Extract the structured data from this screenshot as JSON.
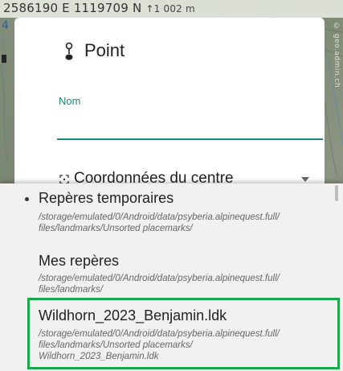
{
  "map": {
    "coordinates": "2586190 E  1119709 N",
    "altitude": "↑1 002 m",
    "side_number": "4",
    "copyright": "© geo.admin.ch"
  },
  "dialog": {
    "title": "Point",
    "field_label": "Nom",
    "field_value": "",
    "coord_label": "Coordonnées du centre"
  },
  "popup": {
    "items": [
      {
        "title": "Repères temporaires",
        "path_lines": [
          "/storage/emulated/0/Android/data/psyberia.alpinequest.full/",
          "files/landmarks/Unsorted placemarks/"
        ]
      },
      {
        "title": "Mes repères",
        "path_lines": [
          "/storage/emulated/0/Android/data/psyberia.alpinequest.full/",
          "files/landmarks/"
        ]
      },
      {
        "title": "Wildhorn_2023_Benjamin.ldk",
        "path_lines": [
          "/storage/emulated/0/Android/data/psyberia.alpinequest.full/",
          "files/landmarks/Unsorted placemarks/",
          "Wildhorn_2023_Benjamin.ldk"
        ]
      }
    ],
    "highlight_color": "#1aa84a"
  },
  "colors": {
    "accent": "#1a8a7e"
  }
}
